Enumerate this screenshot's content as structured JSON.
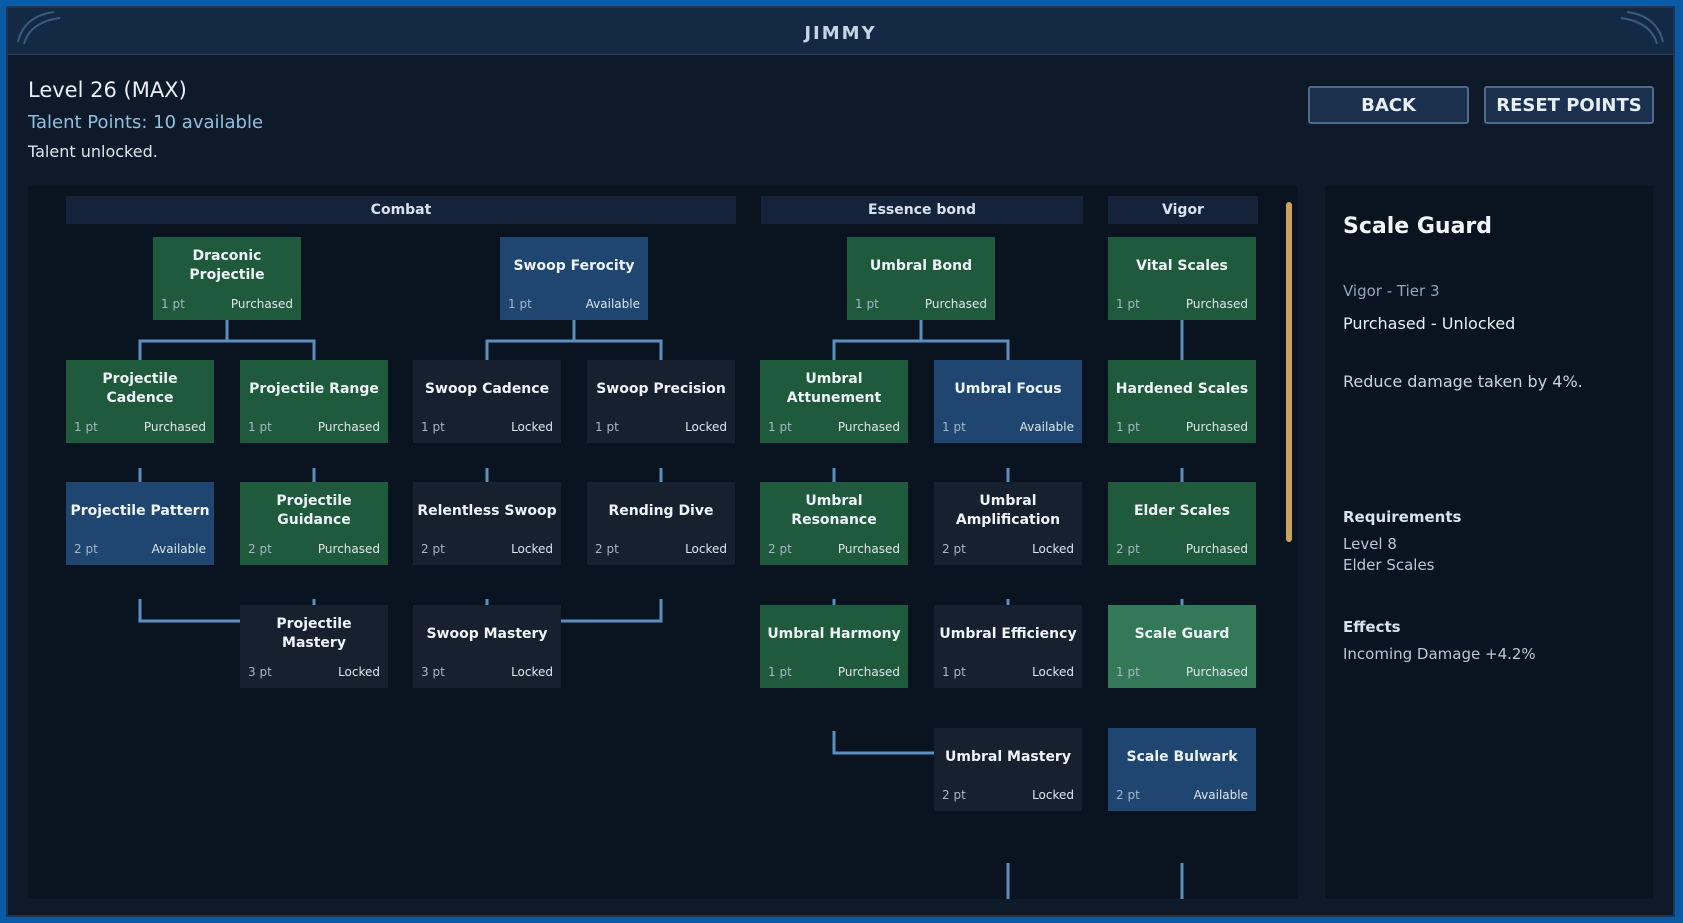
{
  "window": {
    "title": "JIMMY"
  },
  "header": {
    "level": "Level 26 (MAX)",
    "talent_points": "Talent Points: 10 available",
    "status": "Talent unlocked."
  },
  "buttons": {
    "back": "BACK",
    "reset": "RESET POINTS"
  },
  "categories": [
    "Combat",
    "Essence bond",
    "Vigor"
  ],
  "nodes": [
    {
      "name": "Draconic Projectile",
      "cost": "1 pt",
      "state": "Purchased"
    },
    {
      "name": "Swoop Ferocity",
      "cost": "1 pt",
      "state": "Available"
    },
    {
      "name": "Umbral Bond",
      "cost": "1 pt",
      "state": "Purchased"
    },
    {
      "name": "Vital Scales",
      "cost": "1 pt",
      "state": "Purchased"
    },
    {
      "name": "Projectile Cadence",
      "cost": "1 pt",
      "state": "Purchased"
    },
    {
      "name": "Projectile Range",
      "cost": "1 pt",
      "state": "Purchased"
    },
    {
      "name": "Swoop Cadence",
      "cost": "1 pt",
      "state": "Locked"
    },
    {
      "name": "Swoop Precision",
      "cost": "1 pt",
      "state": "Locked"
    },
    {
      "name": "Umbral Attunement",
      "cost": "1 pt",
      "state": "Purchased"
    },
    {
      "name": "Umbral Focus",
      "cost": "1 pt",
      "state": "Available"
    },
    {
      "name": "Hardened Scales",
      "cost": "1 pt",
      "state": "Purchased"
    },
    {
      "name": "Projectile Pattern",
      "cost": "2 pt",
      "state": "Available"
    },
    {
      "name": "Projectile Guidance",
      "cost": "2 pt",
      "state": "Purchased"
    },
    {
      "name": "Relentless Swoop",
      "cost": "2 pt",
      "state": "Locked"
    },
    {
      "name": "Rending Dive",
      "cost": "2 pt",
      "state": "Locked"
    },
    {
      "name": "Umbral Resonance",
      "cost": "2 pt",
      "state": "Purchased"
    },
    {
      "name": "Umbral Amplification",
      "cost": "2 pt",
      "state": "Locked"
    },
    {
      "name": "Elder Scales",
      "cost": "2 pt",
      "state": "Purchased"
    },
    {
      "name": "Projectile Mastery",
      "cost": "3 pt",
      "state": "Locked"
    },
    {
      "name": "Swoop Mastery",
      "cost": "3 pt",
      "state": "Locked"
    },
    {
      "name": "Umbral Harmony",
      "cost": "1 pt",
      "state": "Purchased"
    },
    {
      "name": "Umbral Efficiency",
      "cost": "1 pt",
      "state": "Locked"
    },
    {
      "name": "Scale Guard",
      "cost": "1 pt",
      "state": "Purchased",
      "selected": true
    },
    {
      "name": "Umbral Mastery",
      "cost": "2 pt",
      "state": "Locked"
    },
    {
      "name": "Scale Bulwark",
      "cost": "2 pt",
      "state": "Available"
    }
  ],
  "detail": {
    "title": "Scale Guard",
    "tier": "Vigor - Tier 3",
    "state": "Purchased - Unlocked",
    "description": "Reduce damage taken by 4%.",
    "requirements_header": "Requirements",
    "requirements": [
      "Level 8",
      "Elder Scales"
    ],
    "effects_header": "Effects",
    "effects": [
      "Incoming Damage +4.2%"
    ]
  },
  "colors": {
    "purchased": "#1f5a3c",
    "available": "#1e4670",
    "locked": "#16202f",
    "selected": "#347957",
    "connector": "#5b8fc0",
    "scroll_thumb": "#c9a25c"
  }
}
